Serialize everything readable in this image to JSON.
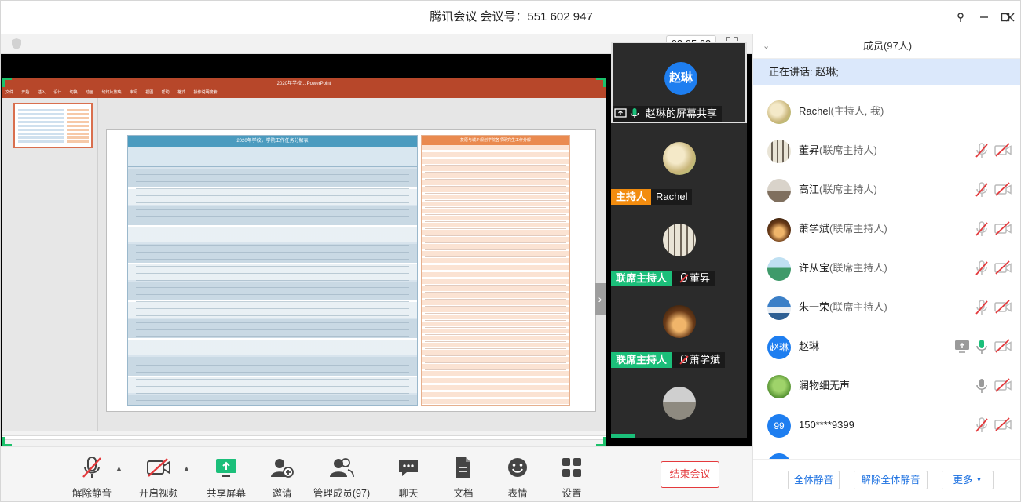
{
  "window": {
    "title": "腾讯会议 会议号：551 602 947"
  },
  "stage": {
    "timer": "02:05:03",
    "presentation": {
      "title": "2020年学校... PowerPoint",
      "tabs": [
        "文件",
        "开始",
        "插入",
        "设计",
        "切换",
        "动画",
        "幻灯片放映",
        "审阅",
        "视图",
        "帮助",
        "格式",
        "操作说明搜索"
      ],
      "slide_table_title": "2020年学校，学院工作任务分解表",
      "slide_table2_title": "复原与城乡规划学院各项研究生工作分解"
    },
    "tiles": [
      {
        "avatar_text": "赵琳",
        "label": "赵琳的屏幕共享",
        "role": ""
      },
      {
        "avatar_text": "",
        "label": "Rachel",
        "role": "主持人"
      },
      {
        "avatar_text": "",
        "label": "董昇",
        "role": "联席主持人"
      },
      {
        "avatar_text": "",
        "label": "萧学斌",
        "role": "联席主持人"
      }
    ]
  },
  "toolbar": {
    "unmute": "解除静音",
    "start_video": "开启视频",
    "share_screen": "共享屏幕",
    "invite": "邀请",
    "manage_members": "管理成员(97)",
    "chat": "聊天",
    "docs": "文档",
    "emoji": "表情",
    "settings": "设置",
    "end_meeting": "结束会议"
  },
  "panel": {
    "title": "成员(97人)",
    "speaking": "正在讲话: 赵琳;",
    "members": [
      {
        "name": "Rachel",
        "role": "(主持人, 我)"
      },
      {
        "name": "董昇",
        "role": "(联席主持人)"
      },
      {
        "name": "高江",
        "role": "(联席主持人)"
      },
      {
        "name": "萧学斌",
        "role": "(联席主持人)"
      },
      {
        "name": "许从宝",
        "role": "(联席主持人)"
      },
      {
        "name": "朱一荣",
        "role": "(联席主持人)"
      },
      {
        "name": "赵琳",
        "role": "",
        "avatar_text": "赵琳"
      },
      {
        "name": "润物细无声",
        "role": ""
      },
      {
        "name": "150****9399",
        "role": "",
        "avatar_text": "99"
      }
    ],
    "mute_all": "全体静音",
    "unmute_all": "解除全体静音",
    "more": "更多"
  },
  "colors": {
    "accent_blue": "#1e7ef0",
    "host_orange": "#f28c0f",
    "cohost_green": "#1bbf7a",
    "end_red": "#e4393c",
    "ppt_red": "#b7472a"
  }
}
